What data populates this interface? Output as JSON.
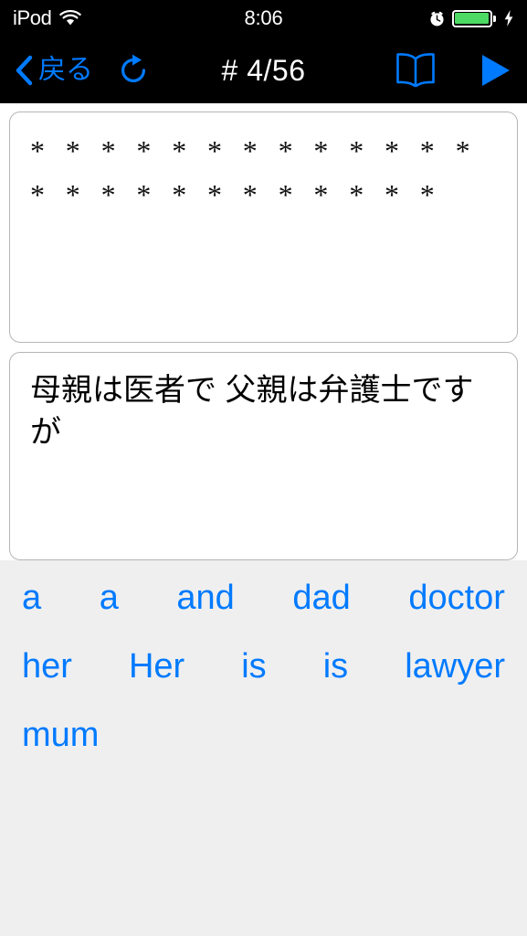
{
  "status_bar": {
    "carrier": "iPod",
    "wifi_icon": "wifi-icon",
    "time": "8:06",
    "alarm_icon": "alarm-clock-icon",
    "battery_icon": "battery-full-icon",
    "charging_icon": "lightning-bolt-icon",
    "battery_color": "#4cd964"
  },
  "nav_bar": {
    "back_label": "戻る",
    "back_icon": "chevron-left-icon",
    "redo_icon": "refresh-clockwise-icon",
    "title": "# 4/56",
    "book_icon": "open-book-icon",
    "play_icon": "play-triangle-icon",
    "tint_color": "#007aff"
  },
  "answer_card": {
    "masked_text": "* * * * * * * * * * * * * * * * * * * * * * * * *"
  },
  "prompt_card": {
    "text": "母親は医者で 父親は弁護士ですが"
  },
  "word_bank": {
    "rows": [
      [
        "a",
        "a",
        "and",
        "dad",
        "doctor"
      ],
      [
        "her",
        "Her",
        "is",
        "is",
        "lawyer"
      ],
      [
        "mum"
      ]
    ]
  }
}
